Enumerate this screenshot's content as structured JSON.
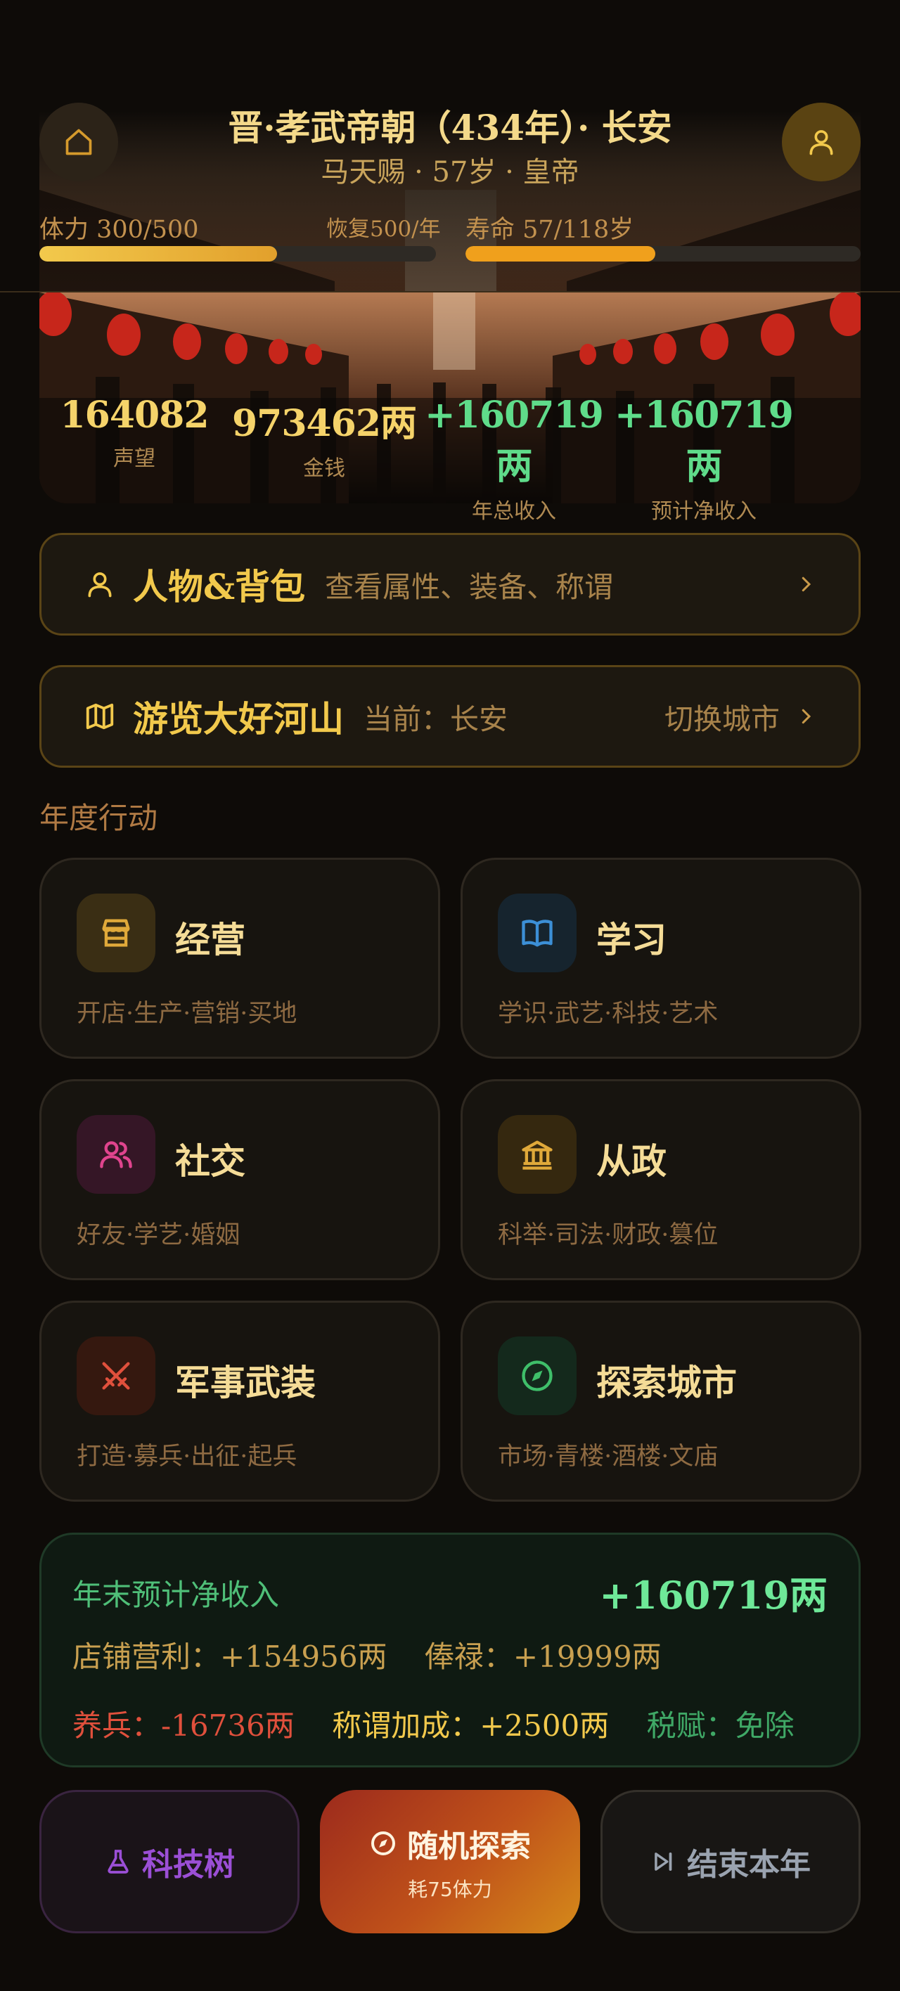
{
  "header": {
    "title": "晋·孝武帝朝（434年）· 长安",
    "subtitle": "马天赐 · 57岁 · 皇帝",
    "stamina_label": "体力 300/500",
    "stamina_recover": "恢复500/年",
    "stamina_fraction": 0.6,
    "lifespan_label": "寿命 57/118岁",
    "lifespan_fraction": 0.48,
    "home_icon": "home-icon",
    "profile_icon": "user-icon"
  },
  "stats": [
    {
      "value": "164082",
      "caption": "声望",
      "color": "#f5d36a"
    },
    {
      "value": "973462两",
      "caption": "金钱",
      "color": "#f5d36a"
    },
    {
      "value": "+160719两",
      "caption": "年总收入",
      "color": "#5fdc8a"
    },
    {
      "value": "+160719两",
      "caption": "预计净收入",
      "color": "#5fdc8a"
    }
  ],
  "character_card": {
    "title": "人物&背包",
    "subtitle": "查看属性、装备、称谓",
    "icon": "user-icon"
  },
  "travel_card": {
    "title": "游览大好河山",
    "subtitle": "当前：长安",
    "action": "切换城市",
    "icon": "map-icon"
  },
  "section_title": "年度行动",
  "actions": [
    {
      "title": "经营",
      "desc": "开店·生产·营销·买地",
      "icon": "shop-icon",
      "icon_bg": "#3a2e14",
      "icon_color": "#e0a93a"
    },
    {
      "title": "学习",
      "desc": "学识·武艺·科技·艺术",
      "icon": "book-icon",
      "icon_bg": "#16242e",
      "icon_color": "#3c8fd6"
    },
    {
      "title": "社交",
      "desc": "好友·学艺·婚姻",
      "icon": "people-icon",
      "icon_bg": "#351626",
      "icon_color": "#e0448e"
    },
    {
      "title": "从政",
      "desc": "科举·司法·财政·篡位",
      "icon": "government-icon",
      "icon_bg": "#35280f",
      "icon_color": "#e0a93a"
    },
    {
      "title": "军事武装",
      "desc": "打造·募兵·出征·起兵",
      "icon": "swords-icon",
      "icon_bg": "#35180f",
      "icon_color": "#e0503c"
    },
    {
      "title": "探索城市",
      "desc": "市场·青楼·酒楼·文庙",
      "icon": "compass-icon",
      "icon_bg": "#14291c",
      "icon_color": "#3fbf6a"
    }
  ],
  "income": {
    "title": "年末预计净收入",
    "total": "+160719两",
    "shop_label": "店铺营利：",
    "shop_value": "+154956两",
    "salary_label": "俸禄：",
    "salary_value": "+19999两",
    "army_label": "养兵：",
    "army_value": "-16736两",
    "title_bonus_label": "称谓加成：",
    "title_bonus_value": "+2500两",
    "tax_label": "税赋：",
    "tax_value": "免除"
  },
  "bottom": {
    "tech_label": "科技树",
    "explore_label": "随机探索",
    "explore_cost": "耗75体力",
    "end_year_label": "结束本年"
  },
  "colors": {
    "gold": "#f2c94c",
    "green": "#5fdc8a",
    "red": "#e0503c",
    "purple": "#9b4fd6"
  }
}
